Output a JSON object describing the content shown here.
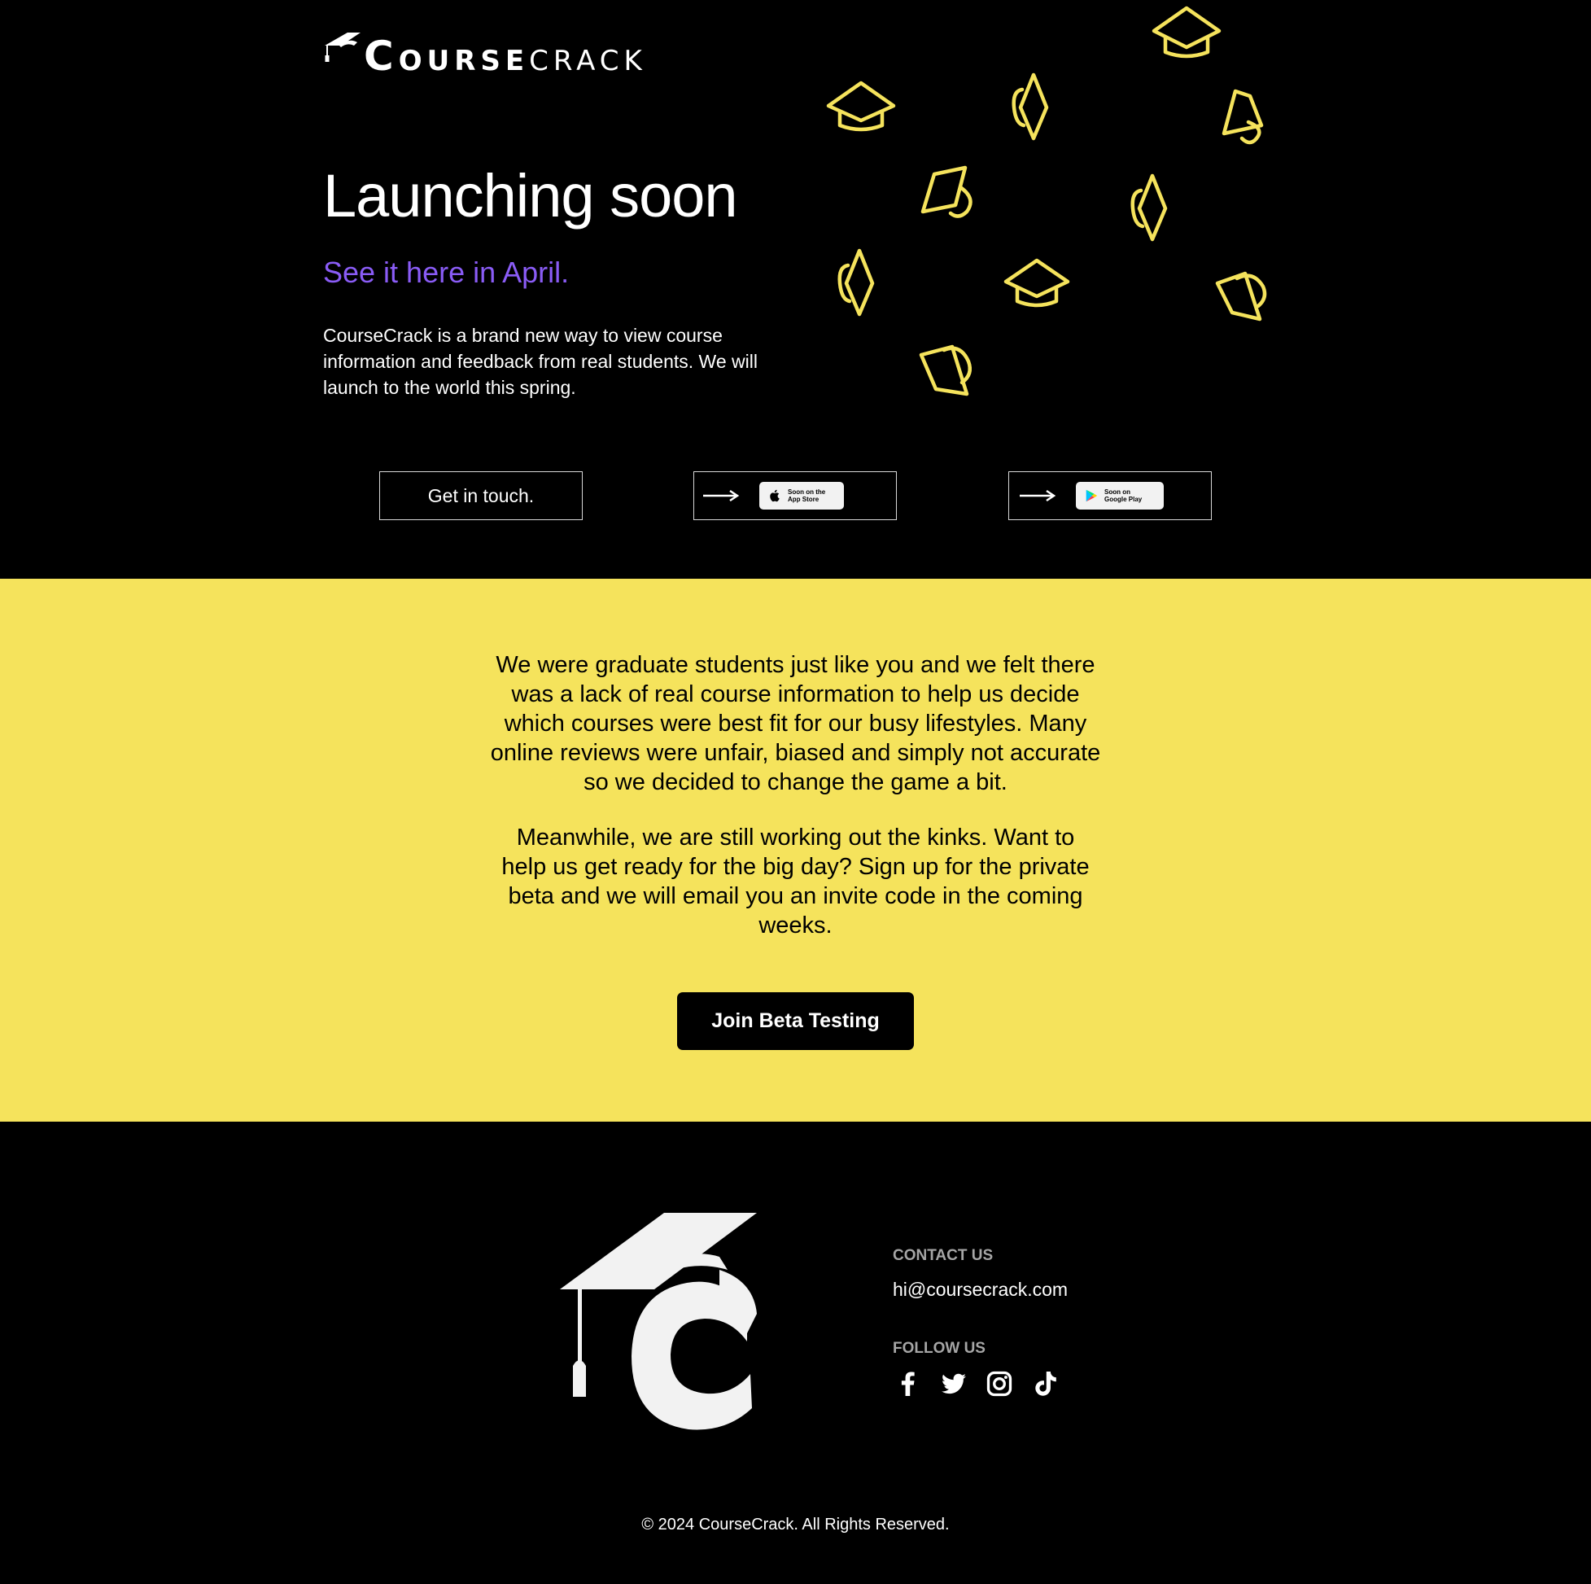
{
  "header": {
    "logo_initial": "C",
    "logo_bold_rest": "OURSE",
    "logo_light": "CRACK"
  },
  "hero": {
    "title": "Launching soon",
    "subtitle": "See it here in April.",
    "description": "CourseCrack is a brand new way to view course information and feedback from real students. We will launch to the world this spring."
  },
  "actions": {
    "contact_label": "Get in touch.",
    "appstore_line1": "Soon on the",
    "appstore_line2": "App Store",
    "play_line1": "Soon on",
    "play_line2": "Google Play"
  },
  "about": {
    "paragraph1": "We were graduate students just like you and we felt there was a lack of real course information to help us decide which courses were best fit for our busy lifestyles. Many online reviews were unfair, biased and simply not accurate so we decided to change the game a bit.",
    "paragraph2": "Meanwhile, we are still working out the kinks. Want to help us get ready for the big day? Sign up for the private beta and we will email you an invite code in the coming weeks.",
    "beta_button": "Join Beta Testing"
  },
  "footer": {
    "contact_heading": "CONTACT US",
    "email": "hi@coursecrack.com",
    "follow_heading": "FOLLOW US",
    "social_icons": [
      "facebook-icon",
      "twitter-icon",
      "instagram-icon",
      "tiktok-icon"
    ],
    "copyright": "© 2024 CourseCrack. All Rights Reserved."
  },
  "colors": {
    "background": "#000000",
    "accent_yellow": "#f5e35c",
    "subtitle_purple": "#8a5cf6",
    "cap_outline": "#f5e35c",
    "muted_heading": "#a6a6a6"
  }
}
